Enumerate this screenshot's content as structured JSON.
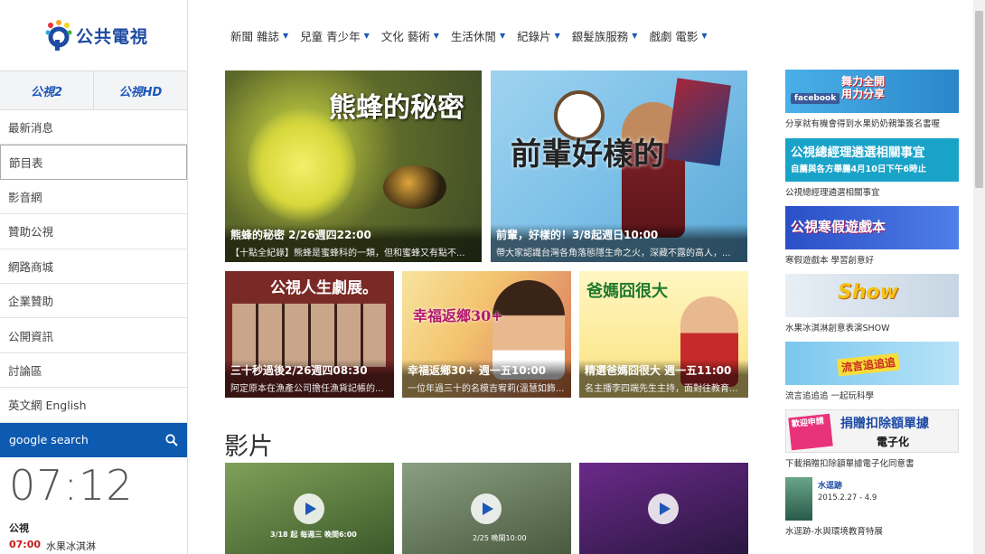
{
  "logo": {
    "text": "公共電視"
  },
  "channels": [
    "公視2",
    "公視HD"
  ],
  "sidebar": {
    "items": [
      "最新消息",
      "節目表",
      "影音網",
      "贊助公視",
      "網路商城",
      "企業贊助",
      "公開資訊",
      "討論區",
      "英文網 English"
    ]
  },
  "search": {
    "label": "google search"
  },
  "clock": {
    "time": "07:12"
  },
  "schedule": {
    "channel": "公視",
    "time": "07:00",
    "program": "水果冰淇淋"
  },
  "topnav": [
    "新聞 雜誌",
    "兒童 青少年",
    "文化 藝術",
    "生活休閒",
    "紀錄片",
    "銀髮族服務",
    "戲劇 電影"
  ],
  "featured": [
    {
      "title": "熊蜂的秘密 2/26週四22:00",
      "desc": "【十點全紀錄】熊蜂是蜜蜂科的一類，但和蜜蜂又有點不...",
      "art": "熊蜂的秘密"
    },
    {
      "title": "前輩，好樣的！3/8起週日10:00",
      "desc": "帶大家認識台灣各角落態隱生命之火，深藏不露的高人，...",
      "art": "前輩好樣的"
    },
    {
      "title": "三十秒過後2/26週四08:30",
      "desc": "阿定原本在漁產公司擔任漁貨記帳的...",
      "art": "公視人生劇展。"
    },
    {
      "title": "幸福返鄉30+ 週一五10:00",
      "desc": "一位年過三十的名模吉宥莉(溫慧如飾...",
      "art": "幸福返鄉30+"
    },
    {
      "title": "精選爸媽囧很大 週一五11:00",
      "desc": "名主播李四端先生主持，面對往教育...",
      "art": "爸媽囧很大"
    }
  ],
  "video_heading": "影片",
  "videos": [
    {
      "caption": "3/18 起 每週三 晚間6:00"
    },
    {
      "caption": "2/25 晚間10:00"
    },
    {
      "caption": ""
    }
  ],
  "banners": [
    {
      "art": "舞力全開 用力分享",
      "caption": "分享就有機會得到水果奶奶親筆簽名書喔"
    },
    {
      "art": "公視總經理遴選相關事宜",
      "art2": "自薦與各方舉薦4月10日下午6時止",
      "caption": "公視總經理遴選相關事宜"
    },
    {
      "art": "公視寒假遊戲本",
      "caption": "寒假遊戲本 學習創意好"
    },
    {
      "art": "Show",
      "caption": "水果冰淇淋創意表演SHOW"
    },
    {
      "art": "流言追追追",
      "caption": "流言追追追 一起玩科學"
    },
    {
      "art": "捐贈扣除額單據",
      "art2": "電子化",
      "art3": "歡迎申請",
      "caption": "下載捐贈扣除額單據電子化同意書"
    },
    {
      "art": "水逕跡",
      "art2": "2015.2.27 - 4.9",
      "caption": "水逕跡-水與環境教育特展"
    }
  ]
}
